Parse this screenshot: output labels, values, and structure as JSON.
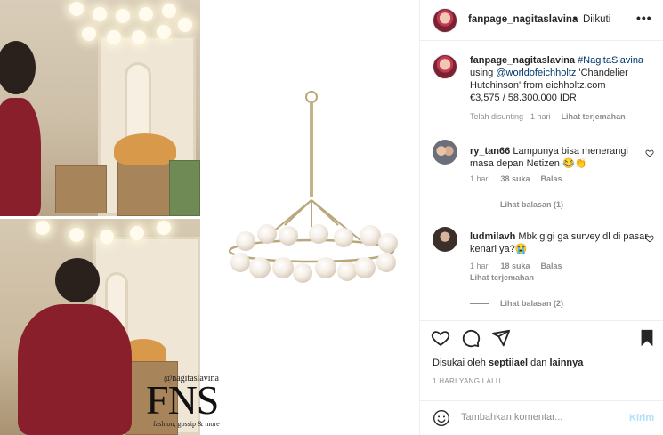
{
  "media": {
    "watermark": {
      "handle": "@nagitaslavina",
      "logo": "FNS",
      "tagline": "fashion, gossip & more"
    }
  },
  "header": {
    "username": "fanpage_nagitaslavina",
    "dot": "•",
    "follow_label": "Diikuti",
    "more_label": "•••"
  },
  "caption": {
    "username": "fanpage_nagitaslavina",
    "hashtag": "#NagitaSlavina",
    "line2_prefix": "using ",
    "mention": "@worldofeichholtz",
    "line2_suffix": " 'Chandelier Hutchinson' from eichholtz.com",
    "price": "€3,575 / 58.300.000 IDR",
    "edited": "Telah disunting · 1 hari",
    "translate": "Lihat terjemahan"
  },
  "comments": [
    {
      "username": "ry_tan66",
      "text": "Lampunya bisa menerangi masa depan Netizen 😂👏",
      "time": "1 hari",
      "likes": "38 suka",
      "reply": "Balas",
      "view_replies": "Lihat balasan (1)"
    },
    {
      "username": "ludmilavh",
      "text": "Mbk gigi ga survey dl di pasar kenari ya?😭",
      "time": "1 hari",
      "likes": "18 suka",
      "reply": "Balas",
      "translate": "Lihat terjemahan",
      "view_replies": "Lihat balasan (2)"
    }
  ],
  "footer": {
    "liked_prefix": "Disukai oleh ",
    "liked_user": "septiiael",
    "liked_mid": " dan ",
    "liked_others": "lainnya",
    "timestamp": "1 HARI YANG LALU",
    "add_comment_placeholder": "Tambahkan komentar...",
    "send_label": "Kirim"
  },
  "icons": {
    "like": "heart-icon",
    "comment": "comment-icon",
    "share": "share-icon",
    "save": "bookmark-icon",
    "emoji": "smile-icon"
  },
  "colors": {
    "link": "#00376b",
    "muted": "#8e8e8e",
    "send_disabled": "#b2dffc"
  }
}
